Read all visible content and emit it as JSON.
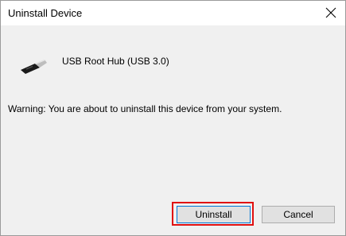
{
  "window": {
    "title": "Uninstall Device",
    "close_icon": "close-icon"
  },
  "device": {
    "icon": "usb-plug-icon",
    "name": "USB Root Hub (USB 3.0)"
  },
  "message": {
    "warning": "Warning: You are about to uninstall this device from your system."
  },
  "buttons": {
    "uninstall_label": "Uninstall",
    "cancel_label": "Cancel"
  },
  "colors": {
    "highlight": "#e01010",
    "focus_border": "#0078d7",
    "content_bg": "#f0f0f0"
  }
}
